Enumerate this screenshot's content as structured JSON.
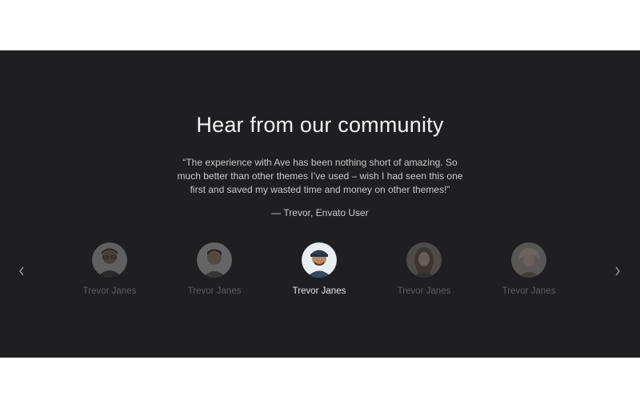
{
  "testimonials": {
    "title": "Hear from our community",
    "quote": "“The experience with Ave has been nothing short of amazing. So much better than other themes I’ve used – wish I had seen this one first and saved my wasted time and money on other themes!”",
    "author": "— Trevor, Envato User",
    "people": [
      {
        "name": "Trevor Janes",
        "active": false
      },
      {
        "name": "Trevor Janes",
        "active": false
      },
      {
        "name": "Trevor Janes",
        "active": true
      },
      {
        "name": "Trevor Janes",
        "active": false
      },
      {
        "name": "Trevor Janes",
        "active": false
      }
    ],
    "prev_icon": "chevron-left-icon",
    "next_icon": "chevron-right-icon"
  },
  "colors": {
    "band_background": "#1f1f21",
    "active_name": "#e6e6e6",
    "inactive_name": "#5c5c5e"
  }
}
